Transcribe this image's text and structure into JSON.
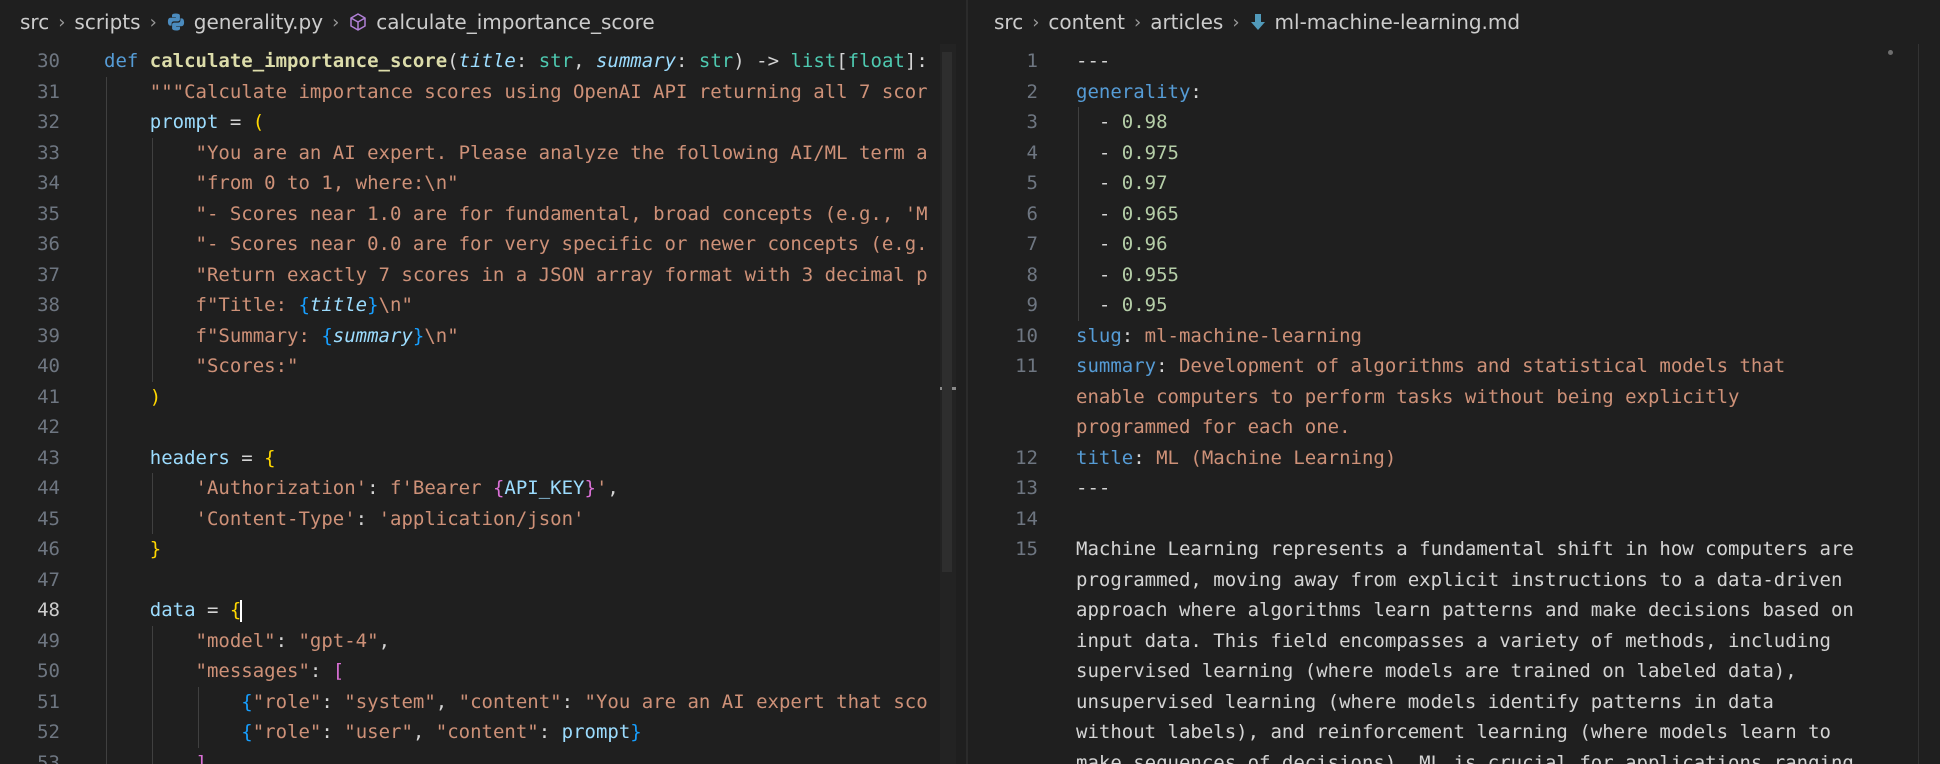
{
  "left": {
    "breadcrumb": [
      "src",
      "scripts",
      "generality.py",
      "calculate_importance_score"
    ],
    "active_line": 48,
    "lines": [
      {
        "n": 30,
        "tokens": [
          [
            "kw",
            "def "
          ],
          [
            "fn",
            "calculate_importance_score"
          ],
          [
            "op",
            "("
          ],
          [
            "pm",
            "title"
          ],
          [
            "op",
            ": "
          ],
          [
            "ty",
            "str"
          ],
          [
            "op",
            ", "
          ],
          [
            "pm",
            "summary"
          ],
          [
            "op",
            ": "
          ],
          [
            "ty",
            "str"
          ],
          [
            "op",
            ") -> "
          ],
          [
            "ty",
            "list"
          ],
          [
            "op",
            "["
          ],
          [
            "ty",
            "float"
          ],
          [
            "op",
            "]:"
          ]
        ]
      },
      {
        "n": 31,
        "tokens": [
          [
            "st",
            "    \"\"\"Calculate importance scores using OpenAI API returning all 7 scor"
          ]
        ]
      },
      {
        "n": 32,
        "tokens": [
          [
            "var",
            "    prompt"
          ],
          [
            "op",
            " = "
          ],
          [
            "br",
            "("
          ]
        ]
      },
      {
        "n": 33,
        "tokens": [
          [
            "st",
            "        \"You are an AI expert. Please analyze the following AI/ML term a"
          ]
        ]
      },
      {
        "n": 34,
        "tokens": [
          [
            "st",
            "        \"from 0 to 1, where:\\n\""
          ]
        ]
      },
      {
        "n": 35,
        "tokens": [
          [
            "st",
            "        \"- Scores near 1.0 are for fundamental, broad concepts (e.g., 'M"
          ]
        ]
      },
      {
        "n": 36,
        "tokens": [
          [
            "st",
            "        \"- Scores near 0.0 are for very specific or newer concepts (e.g."
          ]
        ]
      },
      {
        "n": 37,
        "tokens": [
          [
            "st",
            "        \"Return exactly 7 scores in a JSON array format with 3 decimal p"
          ]
        ]
      },
      {
        "n": 38,
        "tokens": [
          [
            "st",
            "        f\"Title: "
          ],
          [
            "br3",
            "{"
          ],
          [
            "pm",
            "title"
          ],
          [
            "br3",
            "}"
          ],
          [
            "st",
            "\\n\""
          ]
        ]
      },
      {
        "n": 39,
        "tokens": [
          [
            "st",
            "        f\"Summary: "
          ],
          [
            "br3",
            "{"
          ],
          [
            "pm",
            "summary"
          ],
          [
            "br3",
            "}"
          ],
          [
            "st",
            "\\n\""
          ]
        ]
      },
      {
        "n": 40,
        "tokens": [
          [
            "st",
            "        \"Scores:\""
          ]
        ]
      },
      {
        "n": 41,
        "tokens": [
          [
            "br",
            "    )"
          ]
        ]
      },
      {
        "n": 42,
        "tokens": []
      },
      {
        "n": 43,
        "tokens": [
          [
            "var",
            "    headers"
          ],
          [
            "op",
            " = "
          ],
          [
            "br",
            "{"
          ]
        ]
      },
      {
        "n": 44,
        "tokens": [
          [
            "st",
            "        'Authorization'"
          ],
          [
            "op",
            ": "
          ],
          [
            "st",
            "f'Bearer "
          ],
          [
            "br2",
            "{"
          ],
          [
            "var",
            "API_KEY"
          ],
          [
            "br2",
            "}"
          ],
          [
            "st",
            "'"
          ],
          [
            "op",
            ","
          ]
        ]
      },
      {
        "n": 45,
        "tokens": [
          [
            "st",
            "        'Content-Type'"
          ],
          [
            "op",
            ": "
          ],
          [
            "st",
            "'application/json'"
          ]
        ]
      },
      {
        "n": 46,
        "tokens": [
          [
            "br",
            "    }"
          ]
        ]
      },
      {
        "n": 47,
        "tokens": []
      },
      {
        "n": 48,
        "tokens": [
          [
            "var",
            "    data"
          ],
          [
            "op",
            " = "
          ],
          [
            "br",
            "{"
          ],
          [
            "cursor",
            ""
          ]
        ]
      },
      {
        "n": 49,
        "tokens": [
          [
            "st",
            "        \"model\""
          ],
          [
            "op",
            ": "
          ],
          [
            "st",
            "\"gpt-4\""
          ],
          [
            "op",
            ","
          ]
        ]
      },
      {
        "n": 50,
        "tokens": [
          [
            "st",
            "        \"messages\""
          ],
          [
            "op",
            ": "
          ],
          [
            "br2",
            "["
          ]
        ]
      },
      {
        "n": 51,
        "tokens": [
          [
            "br3",
            "            {"
          ],
          [
            "st",
            "\"role\""
          ],
          [
            "op",
            ": "
          ],
          [
            "st",
            "\"system\""
          ],
          [
            "op",
            ", "
          ],
          [
            "st",
            "\"content\""
          ],
          [
            "op",
            ": "
          ],
          [
            "st",
            "\"You are an AI expert that sco"
          ]
        ]
      },
      {
        "n": 52,
        "tokens": [
          [
            "br3",
            "            {"
          ],
          [
            "st",
            "\"role\""
          ],
          [
            "op",
            ": "
          ],
          [
            "st",
            "\"user\""
          ],
          [
            "op",
            ", "
          ],
          [
            "st",
            "\"content\""
          ],
          [
            "op",
            ": "
          ],
          [
            "var",
            "prompt"
          ],
          [
            "br3",
            "}"
          ]
        ]
      },
      {
        "n": 53,
        "tokens": [
          [
            "br2",
            "        ]"
          ],
          [
            "op",
            ","
          ]
        ]
      }
    ]
  },
  "right": {
    "breadcrumb": [
      "src",
      "content",
      "articles",
      "ml-machine-learning.md"
    ],
    "lines": [
      {
        "n": "1",
        "tokens": [
          [
            "dash",
            "---"
          ]
        ]
      },
      {
        "n": "2",
        "tokens": [
          [
            "key",
            "generality"
          ],
          [
            "txt",
            ":"
          ]
        ]
      },
      {
        "n": "3",
        "tokens": [
          [
            "dash",
            "  - "
          ],
          [
            "num",
            "0.98"
          ]
        ]
      },
      {
        "n": "4",
        "tokens": [
          [
            "dash",
            "  - "
          ],
          [
            "num",
            "0.975"
          ]
        ]
      },
      {
        "n": "5",
        "tokens": [
          [
            "dash",
            "  - "
          ],
          [
            "num",
            "0.97"
          ]
        ]
      },
      {
        "n": "6",
        "tokens": [
          [
            "dash",
            "  - "
          ],
          [
            "num",
            "0.965"
          ]
        ]
      },
      {
        "n": "7",
        "tokens": [
          [
            "dash",
            "  - "
          ],
          [
            "num",
            "0.96"
          ]
        ]
      },
      {
        "n": "8",
        "tokens": [
          [
            "dash",
            "  - "
          ],
          [
            "num",
            "0.955"
          ]
        ]
      },
      {
        "n": "9",
        "tokens": [
          [
            "dash",
            "  - "
          ],
          [
            "num",
            "0.95"
          ]
        ]
      },
      {
        "n": "10",
        "tokens": [
          [
            "key",
            "slug"
          ],
          [
            "txt",
            ": "
          ],
          [
            "str",
            "ml-machine-learning"
          ]
        ]
      },
      {
        "n": "11",
        "tokens": [
          [
            "key",
            "summary"
          ],
          [
            "txt",
            ": "
          ],
          [
            "str",
            "Development of algorithms and statistical models that"
          ]
        ]
      },
      {
        "n": "",
        "tokens": [
          [
            "str",
            "enable computers to perform tasks without being explicitly"
          ]
        ]
      },
      {
        "n": "",
        "tokens": [
          [
            "str",
            "programmed for each one."
          ]
        ]
      },
      {
        "n": "12",
        "tokens": [
          [
            "key",
            "title"
          ],
          [
            "txt",
            ": "
          ],
          [
            "str",
            "ML (Machine Learning)"
          ]
        ]
      },
      {
        "n": "13",
        "tokens": [
          [
            "dash",
            "---"
          ]
        ]
      },
      {
        "n": "14",
        "tokens": []
      },
      {
        "n": "15",
        "tokens": [
          [
            "txt",
            "Machine Learning represents a fundamental shift in how computers are"
          ]
        ]
      },
      {
        "n": "",
        "tokens": [
          [
            "txt",
            "programmed, moving away from explicit instructions to a data-driven"
          ]
        ]
      },
      {
        "n": "",
        "tokens": [
          [
            "txt",
            "approach where algorithms learn patterns and make decisions based on"
          ]
        ]
      },
      {
        "n": "",
        "tokens": [
          [
            "txt",
            "input data. This field encompasses a variety of methods, including"
          ]
        ]
      },
      {
        "n": "",
        "tokens": [
          [
            "txt",
            "supervised learning (where models are trained on labeled data),"
          ]
        ]
      },
      {
        "n": "",
        "tokens": [
          [
            "txt",
            "unsupervised learning (where models identify patterns in data"
          ]
        ]
      },
      {
        "n": "",
        "tokens": [
          [
            "txt",
            "without labels), and reinforcement learning (where models learn to"
          ]
        ]
      },
      {
        "n": "",
        "tokens": [
          [
            "txt",
            "make sequences of decisions). ML is crucial for applications ranging"
          ]
        ]
      }
    ]
  },
  "icons": {
    "python": "python-file-icon",
    "symbol": "method-symbol-icon",
    "markdown": "markdown-file-icon"
  }
}
